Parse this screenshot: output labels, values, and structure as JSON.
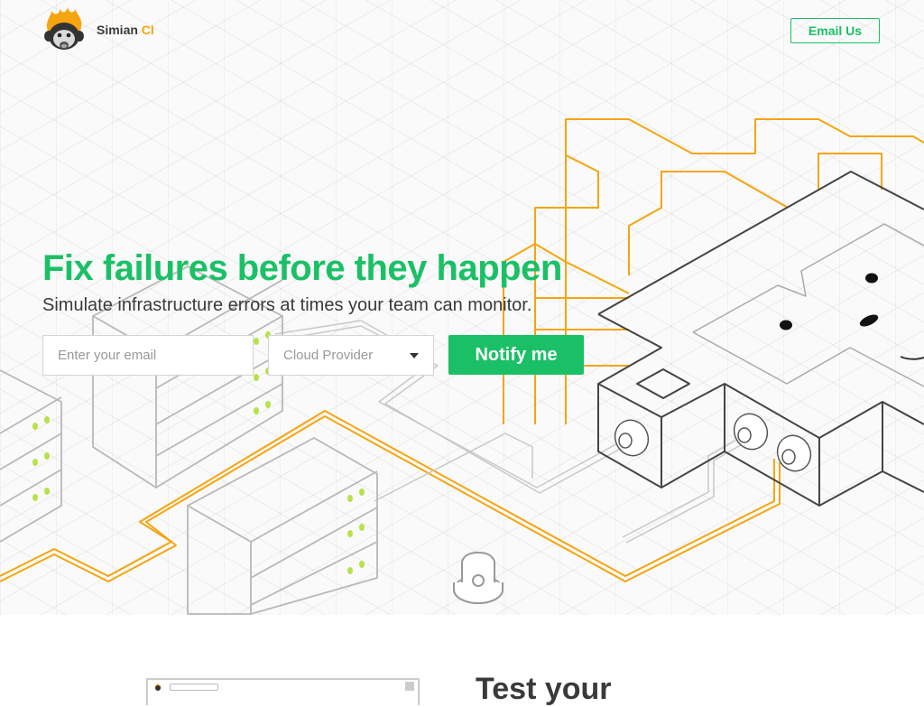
{
  "brand": {
    "name": "Simian",
    "accent": "CI"
  },
  "nav": {
    "email_label": "Email Us"
  },
  "hero": {
    "headline": "Fix failures before they happen",
    "subheadline": "Simulate infrastructure errors at times your team can monitor.",
    "email_placeholder": "Enter your email",
    "provider_placeholder": "Cloud Provider",
    "notify_label": "Notify me"
  },
  "next_section": {
    "title": "Test your"
  },
  "colors": {
    "brand_green": "#1bc066",
    "accent_orange": "#f5a50f",
    "text": "#3a3a3a"
  }
}
